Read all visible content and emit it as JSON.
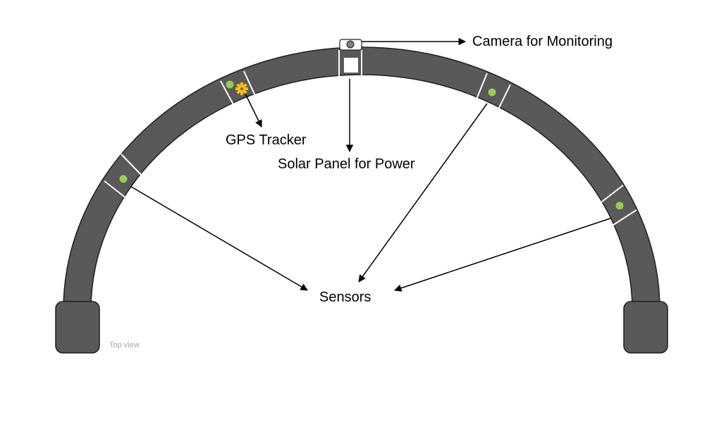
{
  "labels": {
    "camera": "Camera for Monitoring",
    "gps": "GPS Tracker",
    "solar": "Solar Panel for Power",
    "sensors": "Sensors",
    "view": "Top view"
  },
  "components": {
    "arch": "arch-band",
    "feet": [
      "foot-left",
      "foot-right"
    ],
    "sensor_count": 4,
    "gps_icon": "gear-icon",
    "camera_icon": "camera-icon",
    "solar_icon": "solar-panel-icon"
  },
  "colors": {
    "arch_fill": "#595959",
    "outline": "#1f1f1f",
    "divider": "#ffffff",
    "sensor_dot": "#92d050",
    "gps_icon": "#ffc000",
    "arrow": "#000000",
    "caption": "#a6a6a6"
  }
}
